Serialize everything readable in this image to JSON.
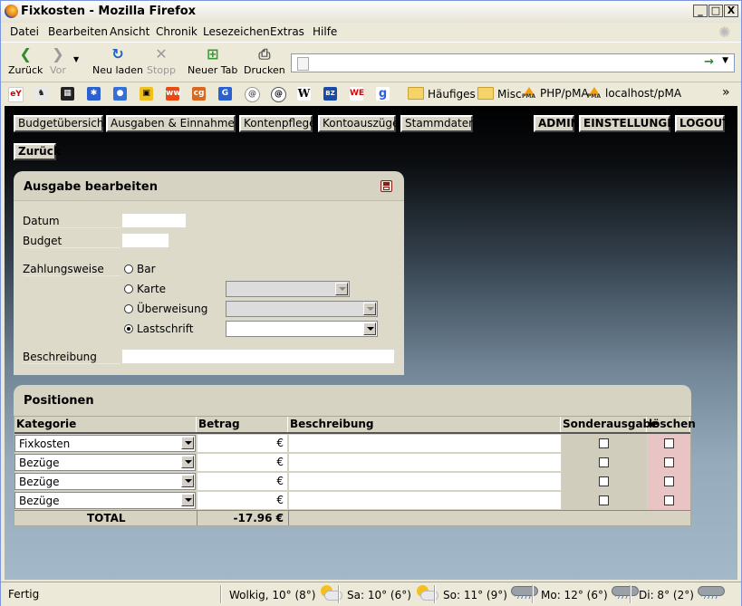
{
  "window": {
    "title": "Fixkosten - Mozilla Firefox",
    "controls": [
      "_",
      "□",
      "X"
    ]
  },
  "menu": [
    "Datei",
    "Bearbeiten",
    "Ansicht",
    "Chronik",
    "Lesezeichen",
    "Extras",
    "Hilfe"
  ],
  "nav": {
    "back": "Zurück",
    "forward": "Vor",
    "reload": "Neu laden",
    "stop": "Stopp",
    "new_tab": "Neuer Tab",
    "print": "Drucken",
    "url": ""
  },
  "bookmarks": {
    "icons": [
      "ebay-icon",
      "user-icon",
      "film-icon",
      "gear-icon",
      "people-icon",
      "lock-icon",
      "www-icon",
      "cg-icon",
      "g-icon",
      "at-icon",
      "at-bold-icon",
      "wikipedia-icon",
      "bz-icon",
      "we-icon",
      "google-icon"
    ],
    "icon_text": [
      "eY",
      "",
      "",
      "",
      "",
      "",
      "ww",
      "cg",
      "G",
      "@",
      "@",
      "W",
      "BZ",
      "WE",
      "g"
    ],
    "folders": [
      "Häufiges",
      "Misc"
    ],
    "links": [
      "PHP/pMA",
      "localhost/pMA"
    ],
    "more": "»"
  },
  "app_nav": {
    "items": [
      "Budgetübersicht",
      "Ausgaben & Einnahmen",
      "Kontenpflege",
      "Kontoauszüge",
      "Stammdaten"
    ],
    "right": [
      "ADMIN",
      "EINSTELLUNGEN",
      "LOGOUT"
    ],
    "back": "Zurück"
  },
  "form": {
    "title": "Ausgabe bearbeiten",
    "fields": {
      "datum_label": "Datum",
      "datum_value": "",
      "budget_label": "Budget",
      "budget_value": ""
    },
    "payment_label": "Zahlungsweise",
    "payment_options": [
      "Bar",
      "Karte",
      "Überweisung",
      "Lastschrift"
    ],
    "payment_selected": "Lastschrift",
    "description_label": "Beschreibung",
    "description_value": ""
  },
  "positions": {
    "title": "Positionen",
    "headers": [
      "Kategorie",
      "Betrag",
      "Beschreibung",
      "Sonderausgabe",
      "löschen"
    ],
    "rows": [
      {
        "kategorie": "Fixkosten",
        "betrag": "",
        "currency": "€",
        "beschreibung": "",
        "sonderausgabe": false,
        "loeschen": false
      },
      {
        "kategorie": "Bezüge",
        "betrag": "",
        "currency": "€",
        "beschreibung": "",
        "sonderausgabe": false,
        "loeschen": false
      },
      {
        "kategorie": "Bezüge",
        "betrag": "",
        "currency": "€",
        "beschreibung": "",
        "sonderausgabe": false,
        "loeschen": false
      },
      {
        "kategorie": "Bezüge",
        "betrag": "",
        "currency": "€",
        "beschreibung": "",
        "sonderausgabe": false,
        "loeschen": false
      }
    ],
    "total_label": "TOTAL",
    "total_value": "-17.96 €"
  },
  "status": {
    "text": "Fertig",
    "weather": [
      "Wolkig, 10° (8°)",
      "Sa: 10° (6°)",
      "So: 11° (9°)",
      "Mo: 12° (6°)",
      "Di: 8° (2°)"
    ]
  },
  "colors": {
    "panel": "#d6d3c2",
    "delete_column": "#e8c4c4",
    "button": "#d9d6c7"
  }
}
